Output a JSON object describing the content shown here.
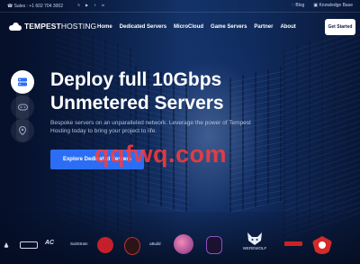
{
  "topbar": {
    "sales_label": "Sales :",
    "phone": "+1 602 704 3002",
    "social_icons": [
      "twitter-icon",
      "youtube-icon",
      "facebook-icon",
      "linkedin-icon"
    ],
    "blog_label": "Blog",
    "knowledge_base_label": "Knowledge Base"
  },
  "brand": {
    "name_bold": "TEMPEST",
    "name_light": "HOSTING"
  },
  "nav": {
    "items": [
      {
        "label": "Home"
      },
      {
        "label": "Dedicated Servers"
      },
      {
        "label": "MicroCloud"
      },
      {
        "label": "Game Servers"
      },
      {
        "label": "Partner"
      },
      {
        "label": "About"
      }
    ],
    "cta_label": "Get Started"
  },
  "side_buttons": [
    "server-icon",
    "gamepad-icon",
    "location-pin-icon"
  ],
  "hero": {
    "title_line1": "Deploy full 10Gbps",
    "title_line2": "Unmetered Servers",
    "subtitle": "Bespoke servers on an unparalleled network. Leverage the power of Tempest Hosting today to bring your project to life.",
    "cta_label": "Explore Dedicated Servers"
  },
  "watermark": "qqfwq.com",
  "partners": [
    {
      "name": "partner-logo-1",
      "label": ""
    },
    {
      "name": "partner-logo-2",
      "label": ""
    },
    {
      "name": "partner-logo-3",
      "label": ""
    },
    {
      "name": "partner-logo-4",
      "label": "SuitStrain"
    },
    {
      "name": "partner-logo-5",
      "label": ""
    },
    {
      "name": "partner-logo-6",
      "label": ""
    },
    {
      "name": "partner-logo-7",
      "label": "uBuild"
    },
    {
      "name": "partner-logo-8",
      "label": ""
    },
    {
      "name": "partner-logo-9",
      "label": ""
    },
    {
      "name": "partner-logo-10",
      "label": "WEREWOLF"
    },
    {
      "name": "partner-logo-11",
      "label": ""
    },
    {
      "name": "partner-logo-12",
      "label": ""
    }
  ],
  "colors": {
    "background": "#071430",
    "accent": "#2b6ef5",
    "watermark": "#ff3a3a"
  }
}
